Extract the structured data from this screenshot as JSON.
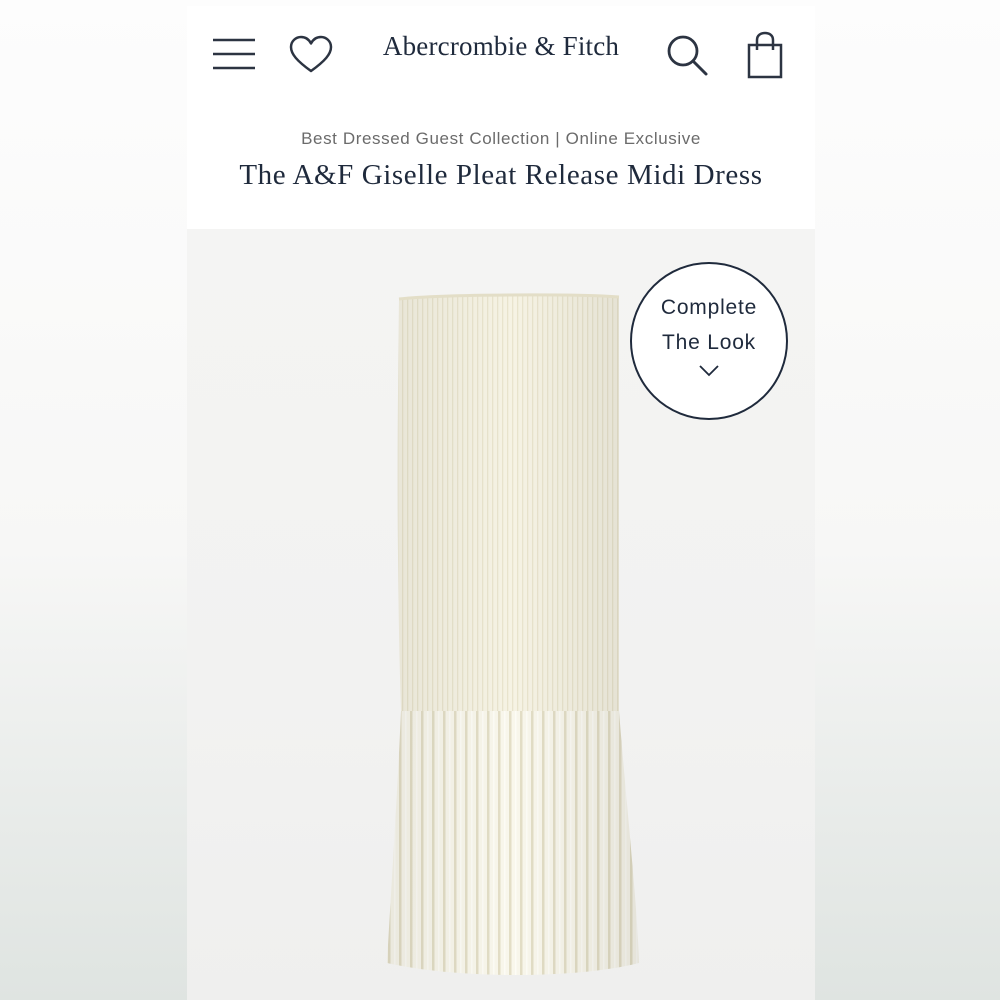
{
  "header": {
    "logo": "Abercrombie & Fitch",
    "icons": [
      "menu-icon",
      "heart-icon",
      "search-icon",
      "shopping-bag-icon"
    ]
  },
  "product": {
    "collection": "Best Dressed Guest Collection | Online Exclusive",
    "name": "The A&F Giselle Pleat Release Midi Dress",
    "complete_the_look": {
      "line1": "Complete",
      "line2": "The Look",
      "icon": "chevron-down-icon"
    }
  },
  "colors": {
    "brand_navy": "#1f2a3c",
    "dress_ivory": "#f5f2e3",
    "image_background": "#f3f3f2"
  }
}
